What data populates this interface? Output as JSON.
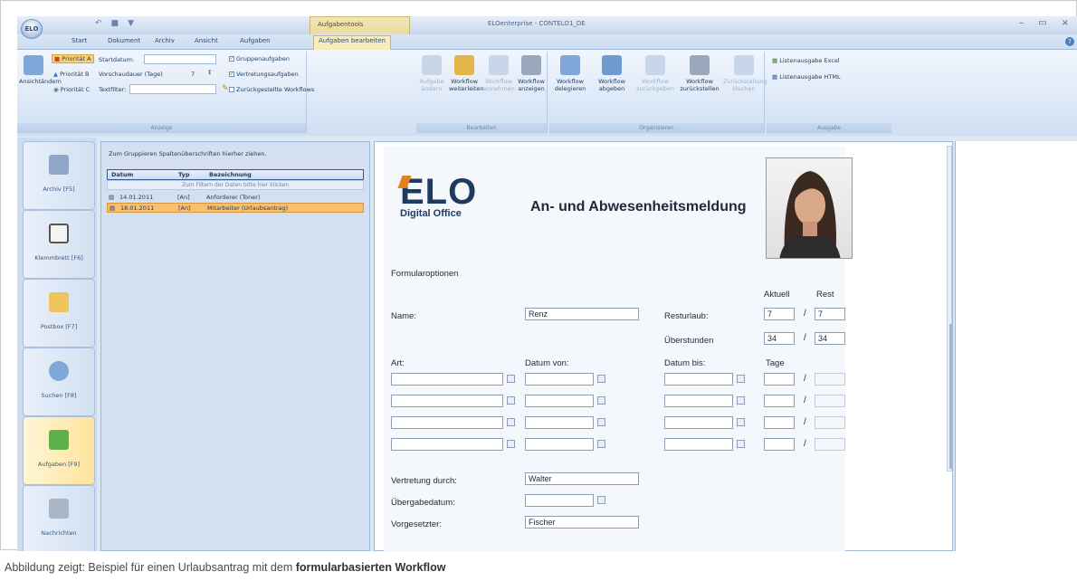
{
  "titlebar": {
    "orb_label": "ELO",
    "context_tab": "Aufgabentools",
    "window_title": "ELOenterprise - CONTELO1_DE",
    "controls": [
      "–",
      "▭",
      "×"
    ],
    "qat_icons": [
      "undo-icon",
      "save-icon",
      "print-icon"
    ]
  },
  "tabs": [
    "Start",
    "Dokument",
    "Archiv",
    "Ansicht",
    "Aufgaben",
    "Aufgaben bearbeiten"
  ],
  "help": "?",
  "ribbon": {
    "anzeige": {
      "label": "Anzeige",
      "view_btn": "Ansichtändern",
      "prio_a": "Priorität A",
      "prio_b": "Priorität B",
      "prio_c": "Priorität C",
      "start_label": "Startdatum:",
      "preview_label": "Vorschaudauer (Tage)",
      "preview_value": "7",
      "textfilter_label": "Textfilter:",
      "chk_group": "Gruppenaufgaben",
      "chk_deputy": "Vertretungsaufgaben",
      "chk_reset": "Zurückgestellte Workflows"
    },
    "bearbeiten": {
      "label": "Bearbeiten",
      "buttons": [
        "Aufgabe ändern",
        "Workflow weiterleiten",
        "Workflow annehmen",
        "Workflow anzeigen"
      ]
    },
    "organisieren": {
      "label": "Organisieren",
      "buttons": [
        "Workflow delegieren",
        "Workflow abgeben",
        "Workflow zurückgeben",
        "Workflow zurückstellen",
        "Zurückstellung löschen"
      ]
    },
    "ausgabe": {
      "label": "Ausgabe",
      "excel": "Listenausgabe Excel",
      "html": "Listenausgabe HTML"
    }
  },
  "nav": [
    {
      "label": "Archiv [F5]",
      "icon": "archive-icon"
    },
    {
      "label": "Klemmbrett [F6]",
      "icon": "clipboard-icon"
    },
    {
      "label": "Postbox [F7]",
      "icon": "postbox-icon"
    },
    {
      "label": "Suchen [F8]",
      "icon": "search-icon"
    },
    {
      "label": "Aufgaben [F9]",
      "icon": "tasks-icon"
    },
    {
      "label": "Nachrichten",
      "icon": "messages-icon"
    }
  ],
  "list": {
    "hint": "Zum Gruppieren Spaltenüberschriften hierher ziehen.",
    "columns": [
      "Datum",
      "Typ",
      "Bezeichnung"
    ],
    "filter_hint": "Zum Filtern der Daten bitte hier klicken",
    "rows": [
      {
        "date": "14.01.2011",
        "type": "[An]",
        "name": "Anforderer (Toner)"
      },
      {
        "date": "18.01.2011",
        "type": "[An]",
        "name": "Mitarbeiter (Urlaubsantrag)"
      }
    ]
  },
  "form": {
    "logo_text": "ELO",
    "logo_sub": "Digital Office",
    "title": "An- und Abwesenheitsmeldung",
    "options": "Formularoptionen",
    "col_current": "Aktuell",
    "col_rest": "Rest",
    "name_label": "Name:",
    "name_value": "Renz",
    "vacation_label": "Resturlaub:",
    "vacation_current": "7",
    "vacation_rest": "7",
    "overtime_label": "Überstunden",
    "overtime_current": "34",
    "overtime_rest": "34",
    "type_label": "Art:",
    "from_label": "Datum von:",
    "to_label": "Datum bis:",
    "days_label": "Tage",
    "deputy_label": "Vertretung durch:",
    "deputy_value": "Walter",
    "handover_label": "Übergabedatum:",
    "supervisor_label": "Vorgesetzter:",
    "supervisor_value": "Fischer"
  },
  "caption": {
    "prefix": "Abbildung zeigt: Beispiel für einen Urlaubsantrag mit dem ",
    "bold": "formularbasierten Workflow"
  }
}
